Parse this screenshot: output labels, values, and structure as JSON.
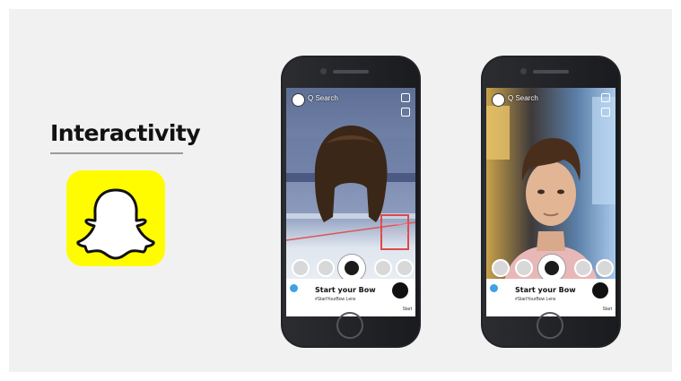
{
  "slide": {
    "heading": "Interactivity",
    "logo_icon": "snapchat-ghost-icon",
    "accent": "#fffc00"
  },
  "phones": [
    {
      "scene": "hockey-arena-with-hair-lens",
      "search_label": "Q Search",
      "promo_title": "Start your Bow",
      "promo_sub": "#StartYourBow Lens",
      "promo_meta": "Start"
    },
    {
      "scene": "young-man-selfie-with-hair-lens",
      "search_label": "Q Search",
      "promo_title": "Start your Bow",
      "promo_sub": "#StartYourBow Lens",
      "promo_meta": "Start"
    }
  ]
}
